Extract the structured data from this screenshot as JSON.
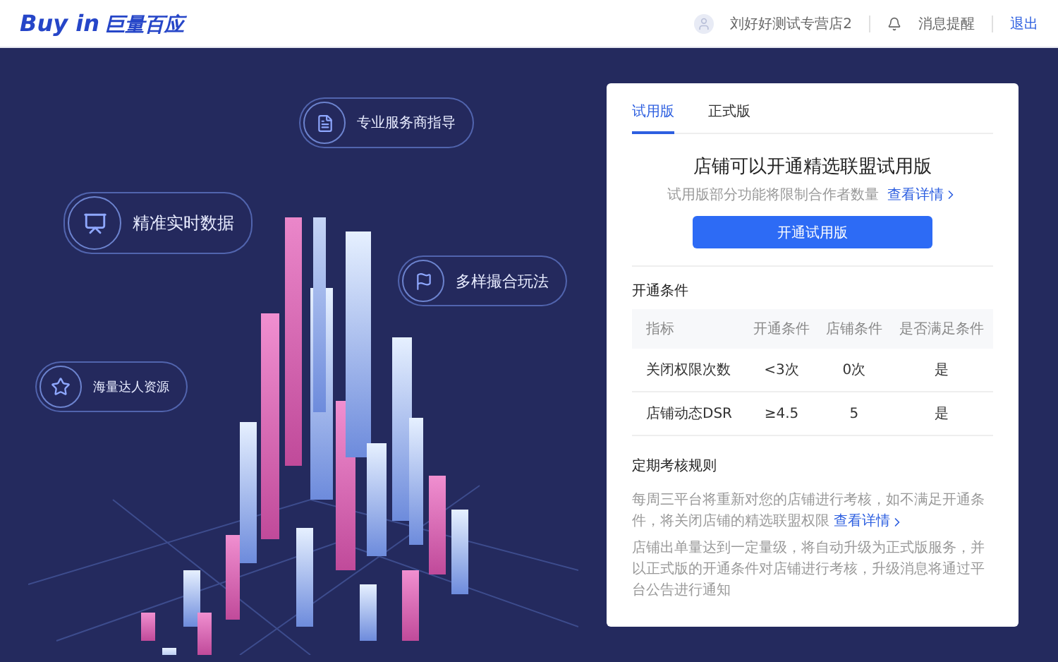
{
  "header": {
    "logo_latin": "Buy in",
    "logo_chinese": "巨量百应",
    "user": "刘好好测试专营店2",
    "notifications": "消息提醒",
    "logout": "退出"
  },
  "hero": {
    "features": [
      {
        "label": "专业服务商指导"
      },
      {
        "label": "精准实时数据"
      },
      {
        "label": "多样撮合玩法"
      },
      {
        "label": "海量达人资源"
      }
    ]
  },
  "card": {
    "tabs": [
      {
        "label": "试用版",
        "selected": true
      },
      {
        "label": "正式版",
        "selected": false
      }
    ],
    "title": "店铺可以开通精选联盟试用版",
    "subtitle": "试用版部分功能将限制合作者数量",
    "subtitle_link": "查看详情",
    "button": "开通试用版",
    "conditions": {
      "heading": "开通条件",
      "columns": [
        "指标",
        "开通条件",
        "店铺条件",
        "是否满足条件"
      ],
      "rows": [
        [
          "关闭权限次数",
          "<3次",
          "0次",
          "是"
        ],
        [
          "店铺动态DSR",
          "≥4.5",
          "5",
          "是"
        ]
      ]
    },
    "rules": {
      "heading": "定期考核规则",
      "paragraphs": [
        {
          "text": "每周三平台将重新对您的店铺进行考核，如不满足开通条件，将关闭店铺的精选联盟权限",
          "link": "查看详情"
        },
        {
          "text": "店铺出单量达到一定量级，将自动升级为正式版服务，并以正式版的开通条件对店铺进行考核，升级消息将通过平台公告进行通知"
        }
      ]
    }
  }
}
